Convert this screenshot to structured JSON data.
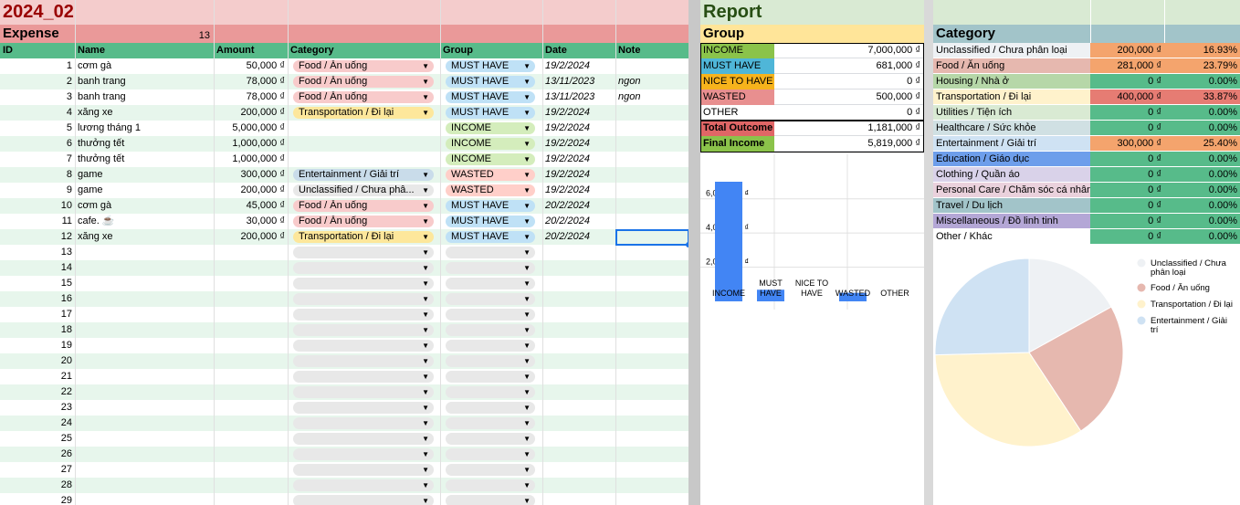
{
  "sheet_title": "2024_02",
  "expense": {
    "label": "Expense",
    "count": "13",
    "headers": [
      "ID",
      "Name",
      "Amount",
      "Category",
      "Group",
      "Date",
      "Note"
    ],
    "rows": [
      {
        "id": "1",
        "name": "cơm gà",
        "amount": "50,000 ₫",
        "category": "Food / Ăn uống",
        "group": "MUST HAVE",
        "date": "19/2/2024",
        "note": ""
      },
      {
        "id": "2",
        "name": "banh trang",
        "amount": "78,000 ₫",
        "category": "Food / Ăn uống",
        "group": "MUST HAVE",
        "date": "13/11/2023",
        "note": "ngon"
      },
      {
        "id": "3",
        "name": "banh trang",
        "amount": "78,000 ₫",
        "category": "Food / Ăn uống",
        "group": "MUST HAVE",
        "date": "13/11/2023",
        "note": "ngon"
      },
      {
        "id": "4",
        "name": "xăng xe",
        "amount": "200,000 ₫",
        "category": "Transportation / Đi lại",
        "group": "MUST HAVE",
        "date": "19/2/2024",
        "note": ""
      },
      {
        "id": "5",
        "name": "lương tháng 1",
        "amount": "5,000,000 ₫",
        "category": "",
        "group": "INCOME",
        "date": "19/2/2024",
        "note": ""
      },
      {
        "id": "6",
        "name": "thưởng tết",
        "amount": "1,000,000 ₫",
        "category": "",
        "group": "INCOME",
        "date": "19/2/2024",
        "note": ""
      },
      {
        "id": "7",
        "name": "thưởng tết",
        "amount": "1,000,000 ₫",
        "category": "",
        "group": "INCOME",
        "date": "19/2/2024",
        "note": ""
      },
      {
        "id": "8",
        "name": "game",
        "amount": "300,000 ₫",
        "category": "Entertainment / Giải trí",
        "group": "WASTED",
        "date": "19/2/2024",
        "note": ""
      },
      {
        "id": "9",
        "name": "game",
        "amount": "200,000 ₫",
        "category": "Unclassified / Chưa phâ...",
        "group": "WASTED",
        "date": "19/2/2024",
        "note": ""
      },
      {
        "id": "10",
        "name": "cơm gà",
        "amount": "45,000 ₫",
        "category": "Food / Ăn uống",
        "group": "MUST HAVE",
        "date": "20/2/2024",
        "note": ""
      },
      {
        "id": "11",
        "name": "cafe. ☕",
        "amount": "30,000 ₫",
        "category": "Food / Ăn uống",
        "group": "MUST HAVE",
        "date": "20/2/2024",
        "note": ""
      },
      {
        "id": "12",
        "name": "xăng xe",
        "amount": "200,000 ₫",
        "category": "Transportation / Đi lại",
        "group": "MUST HAVE",
        "date": "20/2/2024",
        "note": ""
      }
    ],
    "empty_ids": [
      "13",
      "14",
      "15",
      "16",
      "17",
      "18",
      "19",
      "20",
      "21",
      "22",
      "23",
      "24",
      "25",
      "26",
      "27",
      "28",
      "29"
    ]
  },
  "report": {
    "title": "Report",
    "group_header": "Group",
    "groups": [
      {
        "label": "INCOME",
        "value": "7,000,000 ₫",
        "color": "#8bc34a"
      },
      {
        "label": "MUST HAVE",
        "value": "681,000 ₫",
        "color": "#4fb6d8"
      },
      {
        "label": "NICE TO HAVE",
        "value": "0 ₫",
        "color": "#f6b31c"
      },
      {
        "label": "WASTED",
        "value": "500,000 ₫",
        "color": "#e88f8f"
      },
      {
        "label": "OTHER",
        "value": "0 ₫",
        "color": "#ffffff"
      }
    ],
    "total_outcome": {
      "label": "Total Outcome",
      "value": "1,181,000 ₫",
      "color": "#e06666"
    },
    "final_income": {
      "label": "Final Income",
      "value": "5,819,000 ₫",
      "color": "#8bc34a"
    }
  },
  "category_panel": {
    "header": "Category",
    "rows": [
      {
        "label": "Unclassified / Chưa phân loại",
        "amount": "200,000 ₫",
        "pct": "16.93%",
        "color": "#eef1f4",
        "vcolor": "#f4a46d"
      },
      {
        "label": "Food / Ăn uống",
        "amount": "281,000 ₫",
        "pct": "23.79%",
        "color": "#e6b8af",
        "vcolor": "#f4a46d"
      },
      {
        "label": "Housing / Nhà ở",
        "amount": "0 ₫",
        "pct": "0.00%",
        "color": "#b6d7a8",
        "vcolor": "#57bb8a"
      },
      {
        "label": "Transportation / Đi lại",
        "amount": "400,000 ₫",
        "pct": "33.87%",
        "color": "#fff2cc",
        "vcolor": "#e67c73"
      },
      {
        "label": "Utilities / Tiện ích",
        "amount": "0 ₫",
        "pct": "0.00%",
        "color": "#d9ead3",
        "vcolor": "#57bb8a"
      },
      {
        "label": "Healthcare / Sức khỏe",
        "amount": "0 ₫",
        "pct": "0.00%",
        "color": "#d0e0e3",
        "vcolor": "#57bb8a"
      },
      {
        "label": "Entertainment / Giải trí",
        "amount": "300,000 ₫",
        "pct": "25.40%",
        "color": "#cfe2f3",
        "vcolor": "#f4a46d"
      },
      {
        "label": "Education / Giáo dục",
        "amount": "0 ₫",
        "pct": "0.00%",
        "color": "#6d9eeb",
        "vcolor": "#57bb8a"
      },
      {
        "label": "Clothing / Quần áo",
        "amount": "0 ₫",
        "pct": "0.00%",
        "color": "#d9d2e9",
        "vcolor": "#57bb8a"
      },
      {
        "label": "Personal Care / Chăm sóc cá nhân",
        "amount": "0 ₫",
        "pct": "0.00%",
        "color": "#ead1dc",
        "vcolor": "#57bb8a"
      },
      {
        "label": "Travel / Du lịch",
        "amount": "0 ₫",
        "pct": "0.00%",
        "color": "#a2c4c9",
        "vcolor": "#57bb8a"
      },
      {
        "label": "Miscellaneous / Đồ linh tinh",
        "amount": "0 ₫",
        "pct": "0.00%",
        "color": "#b4a7d6",
        "vcolor": "#57bb8a"
      },
      {
        "label": "Other / Khác",
        "amount": "0 ₫",
        "pct": "0.00%",
        "color": "#ffffff",
        "vcolor": "#57bb8a"
      }
    ]
  },
  "chip_colors": {
    "Food / Ăn uống": "#f8cbcb",
    "Transportation / Đi lại": "#fde79b",
    "Entertainment / Giải trí": "#c9dcea",
    "Unclassified / Chưa phâ...": "#e8e8e8",
    "MUST HAVE": "#bfe1f6",
    "INCOME": "#d4edbc",
    "WASTED": "#ffcfc9"
  },
  "chart_data": [
    {
      "type": "bar",
      "categories": [
        "INCOME",
        "MUST HAVE",
        "NICE TO HAVE",
        "WASTED",
        "OTHER"
      ],
      "values": [
        7000000,
        681000,
        0,
        500000,
        0
      ],
      "ytick_labels": [
        "2,000,000 ₫",
        "4,000,000 ₫",
        "6,000,000 ₫"
      ],
      "yticks": [
        2000000,
        4000000,
        6000000
      ],
      "color": "#4285f4"
    },
    {
      "type": "pie",
      "labels": [
        "Unclassified / Chưa phân loại",
        "Food / Ăn uống",
        "Transportation / Đi lại",
        "Entertainment / Giải trí"
      ],
      "values": [
        200000,
        281000,
        400000,
        300000
      ],
      "colors": [
        "#eef1f4",
        "#e6b8af",
        "#fff2cc",
        "#cfe2f3"
      ],
      "legend": "right"
    }
  ]
}
